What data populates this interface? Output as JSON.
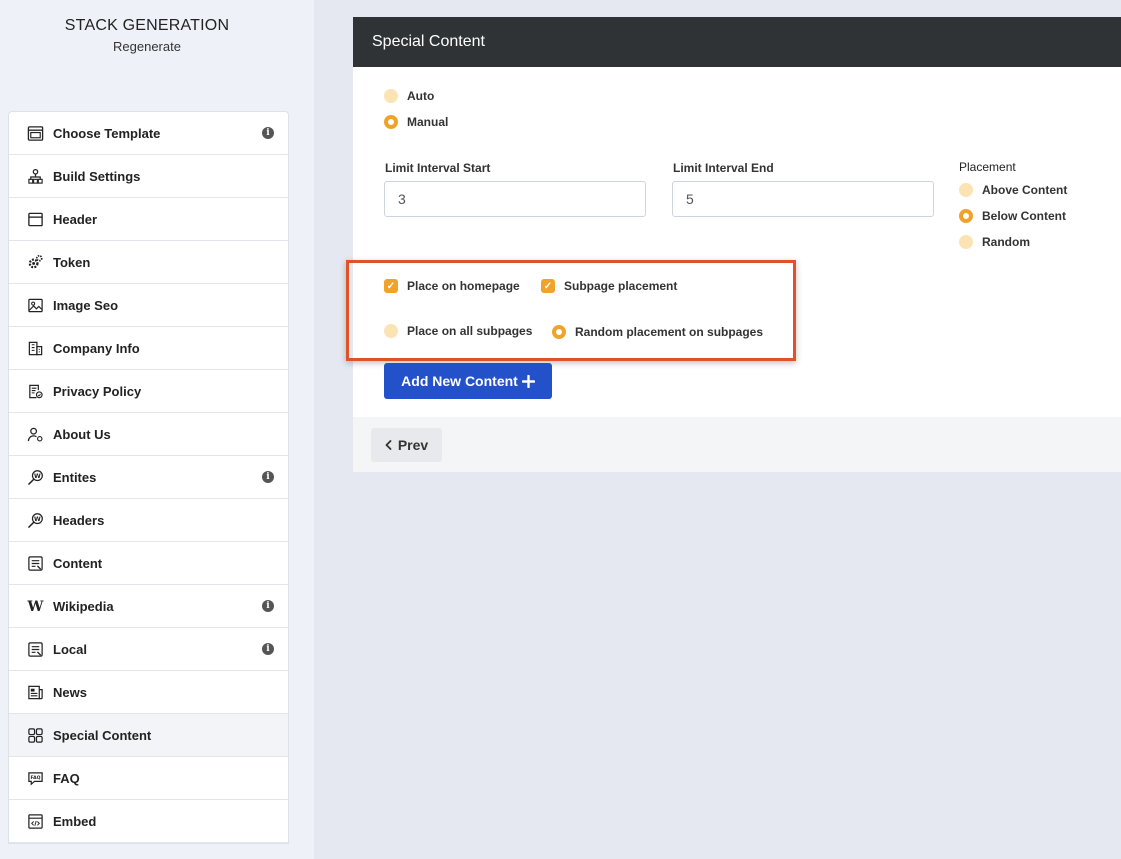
{
  "brand": {
    "title": "STACK GENERATION",
    "subtitle": "Regenerate"
  },
  "sidebar": {
    "items": [
      {
        "label": "Choose Template",
        "icon": "template-icon",
        "info": true
      },
      {
        "label": "Build Settings",
        "icon": "hierarchy-icon",
        "info": false
      },
      {
        "label": "Header",
        "icon": "header-icon",
        "info": false
      },
      {
        "label": "Token",
        "icon": "gears-icon",
        "info": false
      },
      {
        "label": "Image Seo",
        "icon": "image-icon",
        "info": false
      },
      {
        "label": "Company Info",
        "icon": "building-icon",
        "info": false
      },
      {
        "label": "Privacy Policy",
        "icon": "policy-icon",
        "info": false
      },
      {
        "label": "About Us",
        "icon": "user-settings-icon",
        "info": false
      },
      {
        "label": "Entites",
        "icon": "wiki-search-icon",
        "info": true
      },
      {
        "label": "Headers",
        "icon": "wiki-search-icon",
        "info": false
      },
      {
        "label": "Content",
        "icon": "content-icon",
        "info": false
      },
      {
        "label": "Wikipedia",
        "icon": "wikipedia-icon",
        "info": true
      },
      {
        "label": "Local",
        "icon": "content-icon",
        "info": true
      },
      {
        "label": "News",
        "icon": "news-icon",
        "info": false
      },
      {
        "label": "Special Content",
        "icon": "grid-icon",
        "info": false,
        "active": true
      },
      {
        "label": "FAQ",
        "icon": "faq-icon",
        "info": false
      },
      {
        "label": "Embed",
        "icon": "embed-icon",
        "info": false
      }
    ],
    "info_glyph": "i"
  },
  "card": {
    "title": "Special Content",
    "mode": {
      "auto": "Auto",
      "manual": "Manual",
      "selected": "Manual"
    },
    "limit_start": {
      "label": "Limit Interval Start",
      "value": "3"
    },
    "limit_end": {
      "label": "Limit Interval End",
      "value": "5"
    },
    "placement": {
      "label": "Placement",
      "above": "Above Content",
      "below": "Below Content",
      "random": "Random",
      "selected": "Below Content"
    },
    "place_homepage": "Place on homepage",
    "subpage_placement": "Subpage placement",
    "all_subpages": "Place on all subpages",
    "random_subpages": "Random placement on subpages",
    "add_button": "Add New Content",
    "prev_button": "Prev"
  },
  "colors": {
    "accent": "#f0a32a",
    "primary": "#2251c9",
    "header_bg": "#2f3336",
    "highlight": "#e0522a"
  }
}
